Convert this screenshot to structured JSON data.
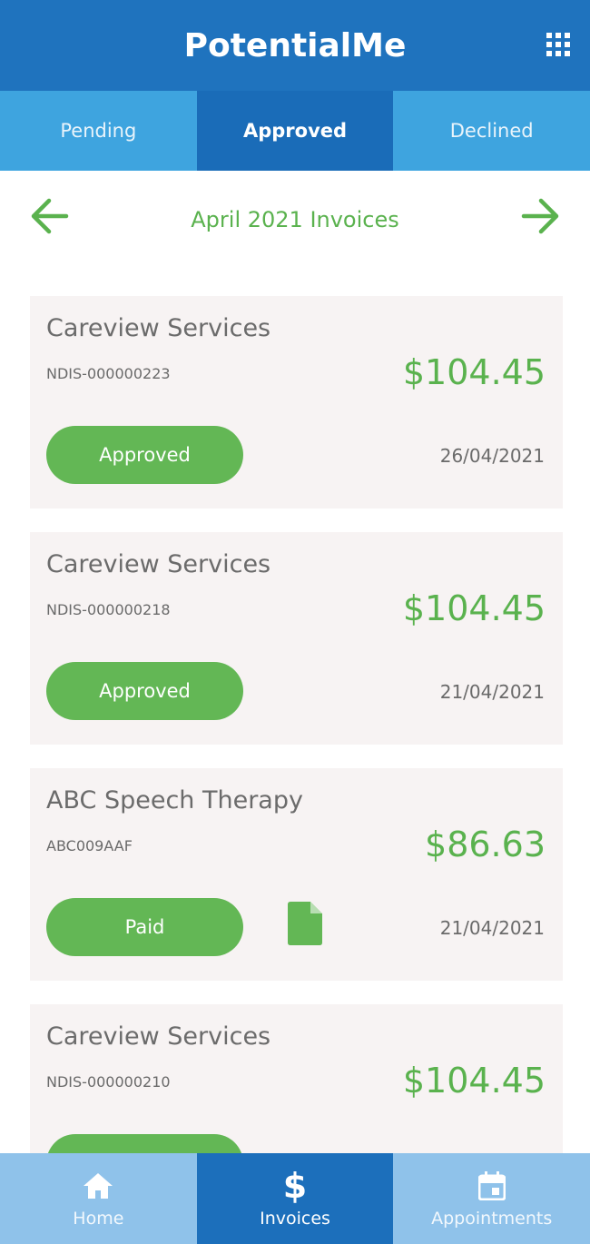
{
  "app": {
    "title": "PotentialMe",
    "menu_icon": "grid-icon"
  },
  "tabs": [
    {
      "label": "Pending",
      "active": false
    },
    {
      "label": "Approved",
      "active": true
    },
    {
      "label": "Declined",
      "active": false
    }
  ],
  "month_nav": {
    "title": "April 2021 Invoices",
    "prev_icon": "arrow-left-icon",
    "next_icon": "arrow-right-icon"
  },
  "invoices": [
    {
      "provider": "Careview Services",
      "reference": "NDIS-000000223",
      "amount": "$104.45",
      "status": "Approved",
      "date": "26/04/2021",
      "has_document": false
    },
    {
      "provider": "Careview Services",
      "reference": "NDIS-000000218",
      "amount": "$104.45",
      "status": "Approved",
      "date": "21/04/2021",
      "has_document": false
    },
    {
      "provider": "ABC Speech Therapy",
      "reference": "ABC009AAF",
      "amount": "$86.63",
      "status": "Paid",
      "date": "21/04/2021",
      "has_document": true
    },
    {
      "provider": "Careview Services",
      "reference": "NDIS-000000210",
      "amount": "$104.45",
      "status": "",
      "date": "",
      "has_document": false
    }
  ],
  "bottom_nav": [
    {
      "label": "Home",
      "icon": "home-icon",
      "active": false
    },
    {
      "label": "Invoices",
      "icon": "dollar-icon",
      "active": true
    },
    {
      "label": "Appointments",
      "icon": "calendar-icon",
      "active": false
    }
  ],
  "colors": {
    "header": "#1f73be",
    "tab_bar": "#3ea4df",
    "tab_active": "#1a6cb8",
    "accent_green": "#5ab24e",
    "card_bg": "#f7f3f3",
    "bottom_nav": "#8fc2ea",
    "bottom_nav_active": "#1c6fbb"
  }
}
